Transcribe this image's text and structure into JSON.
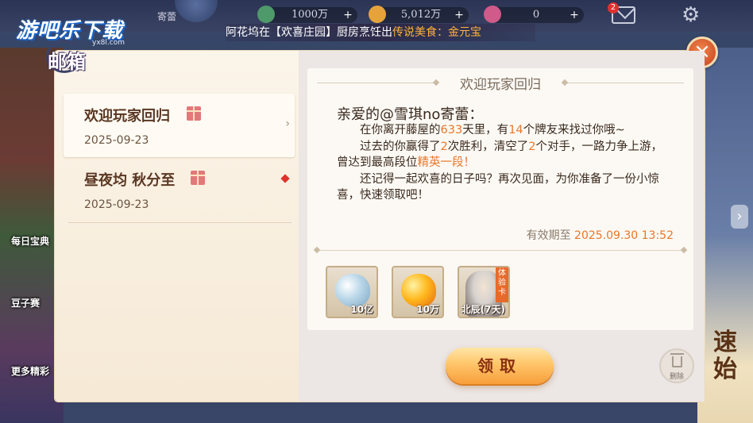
{
  "watermark": {
    "text": "游吧乐下载",
    "sub": "yx8l.com"
  },
  "topbar": {
    "name_fragment": "寄蕾",
    "resources": [
      {
        "icon": "chip-icon",
        "value": "1000万"
      },
      {
        "icon": "gold-bean-icon",
        "value": "5,012万"
      },
      {
        "icon": "gem-icon",
        "value": "0"
      }
    ],
    "mail_badge": "2",
    "plus": "+"
  },
  "marquee": {
    "prefix": "阿花坞在【欢喜庄园】厨房烹饪出",
    "highlight": "传说美食：金元宝"
  },
  "background": {
    "left_labels": [
      "每日宝典",
      "豆子赛",
      "更多精彩"
    ],
    "right_text": "速始",
    "right_arrow": "›"
  },
  "dialog": {
    "title": "邮箱",
    "close": "×",
    "mails": [
      {
        "title": "欢迎玩家回归",
        "date": "2025-09-23",
        "selected": true
      },
      {
        "title": "昼夜均 秋分至",
        "date": "2025-09-23",
        "selected": false
      }
    ],
    "letter": {
      "heading": "欢迎玩家回归",
      "greeting": "亲爱的@雪琪no寄蕾：",
      "p1_a": "在你离开藤屋的",
      "p1_days": "633",
      "p1_b": "天里，有",
      "p1_friends": "14",
      "p1_c": "个牌友来找过你哦~",
      "p2_a": "过去的你赢得了",
      "p2_wins": "2",
      "p2_b": "次胜利，清空了",
      "p2_opps": "2",
      "p2_c": "个对手，一路力争上游，曾达到最高段位",
      "p2_rank": "精英一段",
      "p2_d": "！",
      "p3": "还记得一起欢喜的日子吗？再次见面，为你准备了一份小惊喜，快速领取吧！",
      "expiry_label": "有效期至",
      "expiry_date": "2025.09.30  13:52"
    },
    "rewards": [
      {
        "icon": "silver-bean-icon",
        "qty": "10亿"
      },
      {
        "icon": "gold-bean-icon",
        "qty": "10万"
      },
      {
        "icon": "hero-card-icon",
        "qty": "北辰(7天)",
        "tag": "体验卡"
      }
    ],
    "claim_label": "领取",
    "delete_label": "删除"
  }
}
